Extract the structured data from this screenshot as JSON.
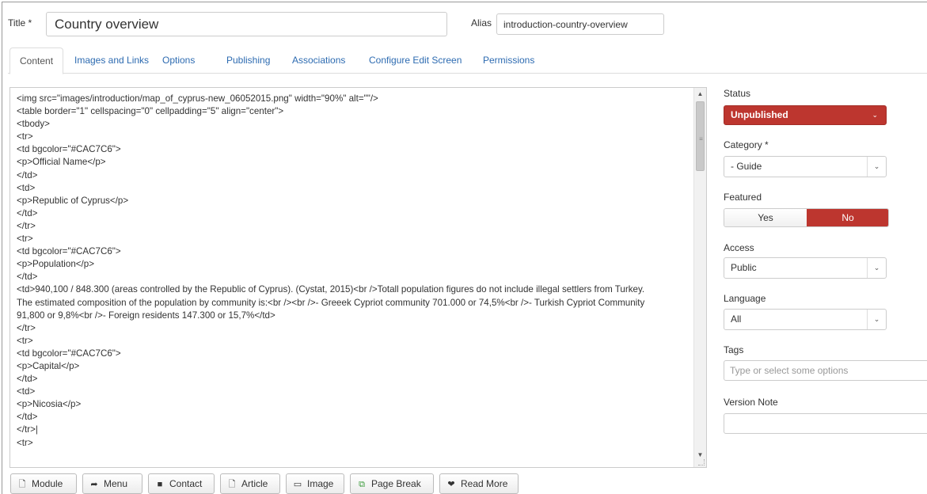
{
  "form": {
    "title_label": "Title *",
    "title_value": "Country overview",
    "alias_label": "Alias",
    "alias_value": "introduction-country-overview"
  },
  "tabs": [
    {
      "label": "Content"
    },
    {
      "label": "Images and Links"
    },
    {
      "label": "Options"
    },
    {
      "label": "Publishing"
    },
    {
      "label": "Associations"
    },
    {
      "label": "Configure Edit Screen"
    },
    {
      "label": "Permissions"
    }
  ],
  "editor": {
    "lines": [
      "<img src=\"images/introduction/map_of_cyprus-new_06052015.png\" width=\"90%\" alt=\"\"/>",
      "<table border=\"1\" cellspacing=\"0\" cellpadding=\"5\" align=\"center\">",
      "<tbody>",
      "<tr>",
      "<td bgcolor=\"#CAC7C6\">",
      "<p>Official Name</p>",
      "</td>",
      "<td>",
      "<p>Republic of Cyprus</p>",
      "</td>",
      "</tr>",
      "<tr>",
      "<td bgcolor=\"#CAC7C6\">",
      "<p>Population</p>",
      "</td>",
      "<td>940,100 / 848.300 (areas controlled by the Republic of Cyprus). (Cystat, 2015)<br />Totall population figures do not include illegal settlers from Turkey.",
      "The estimated composition of the population by community is:<br /><br />- Greeek Cypriot community 701.000 or 74,5%<br />- Turkish Cypriot Community",
      "91,800 or 9,8%<br />- Foreign residents 147.300 or 15,7%</td>",
      "</tr>",
      "<tr>",
      "<td bgcolor=\"#CAC7C6\">",
      "<p>Capital</p>",
      "</td>",
      "<td>",
      "<p>Nicosia</p>",
      "</td>",
      "</tr>|",
      "<tr>"
    ],
    "buttons": [
      {
        "label": "Module",
        "icon": "file-plus-icon"
      },
      {
        "label": "Menu",
        "icon": "share-icon"
      },
      {
        "label": "Contact",
        "icon": "address-book-icon"
      },
      {
        "label": "Article",
        "icon": "file-plus-icon"
      },
      {
        "label": "Image",
        "icon": "picture-icon"
      },
      {
        "label": "Page Break",
        "icon": "copy-icon"
      },
      {
        "label": "Read More",
        "icon": "chevron-down-icon"
      }
    ]
  },
  "sidebar": {
    "status_label": "Status",
    "status_value": "Unpublished",
    "category_label": "Category *",
    "category_value": "- Guide",
    "featured_label": "Featured",
    "featured_yes": "Yes",
    "featured_no": "No",
    "access_label": "Access",
    "access_value": "Public",
    "language_label": "Language",
    "language_value": "All",
    "tags_label": "Tags",
    "tags_placeholder": "Type or select some options",
    "version_note_label": "Version Note",
    "version_note_value": ""
  },
  "colors": {
    "danger": "#bd362f",
    "link": "#2d6bb1"
  }
}
